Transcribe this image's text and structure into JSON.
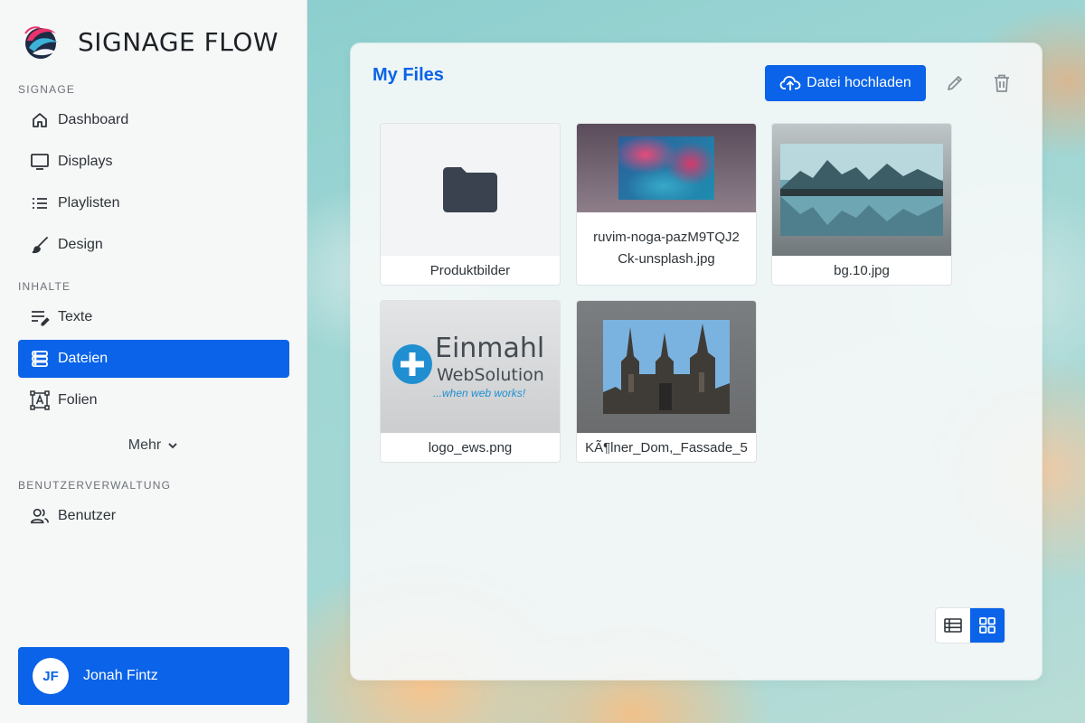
{
  "brand": {
    "name": "SIGNAGE FLOW"
  },
  "sidebar": {
    "sections": [
      {
        "label": "SIGNAGE"
      },
      {
        "label": "INHALTE"
      },
      {
        "label": "BENUTZERVERWALTUNG"
      }
    ],
    "items": [
      {
        "label": "Dashboard",
        "icon": "home-icon"
      },
      {
        "label": "Displays",
        "icon": "monitor-icon"
      },
      {
        "label": "Playlisten",
        "icon": "list-icon"
      },
      {
        "label": "Design",
        "icon": "brush-icon"
      },
      {
        "label": "Texte",
        "icon": "text-edit-icon"
      },
      {
        "label": "Dateien",
        "icon": "storage-icon",
        "active": true
      },
      {
        "label": "Folien",
        "icon": "slide-icon"
      },
      {
        "label": "Benutzer",
        "icon": "users-icon"
      }
    ],
    "more_label": "Mehr",
    "user": {
      "initials": "JF",
      "name": "Jonah Fintz"
    }
  },
  "main": {
    "title": "My Files",
    "upload_label": "Datei hochladen",
    "files": [
      {
        "name": "Produktbilder",
        "type": "folder"
      },
      {
        "name": "ruvim-noga-pazM9TQJ2Ck-unsplash.jpg",
        "type": "image"
      },
      {
        "name": "bg.10.jpg",
        "type": "image"
      },
      {
        "name": "logo_ews.png",
        "type": "image"
      },
      {
        "name": "KÃ¶lner_Dom,_Fassade_5",
        "type": "image"
      }
    ],
    "logo_text": {
      "line1": "Einmahl",
      "line2": "WebSolution",
      "tagline": "...when web works!"
    },
    "view_mode": "grid"
  },
  "colors": {
    "accent": "#0a63e8",
    "text": "#2d3338",
    "muted": "#6b7177"
  }
}
